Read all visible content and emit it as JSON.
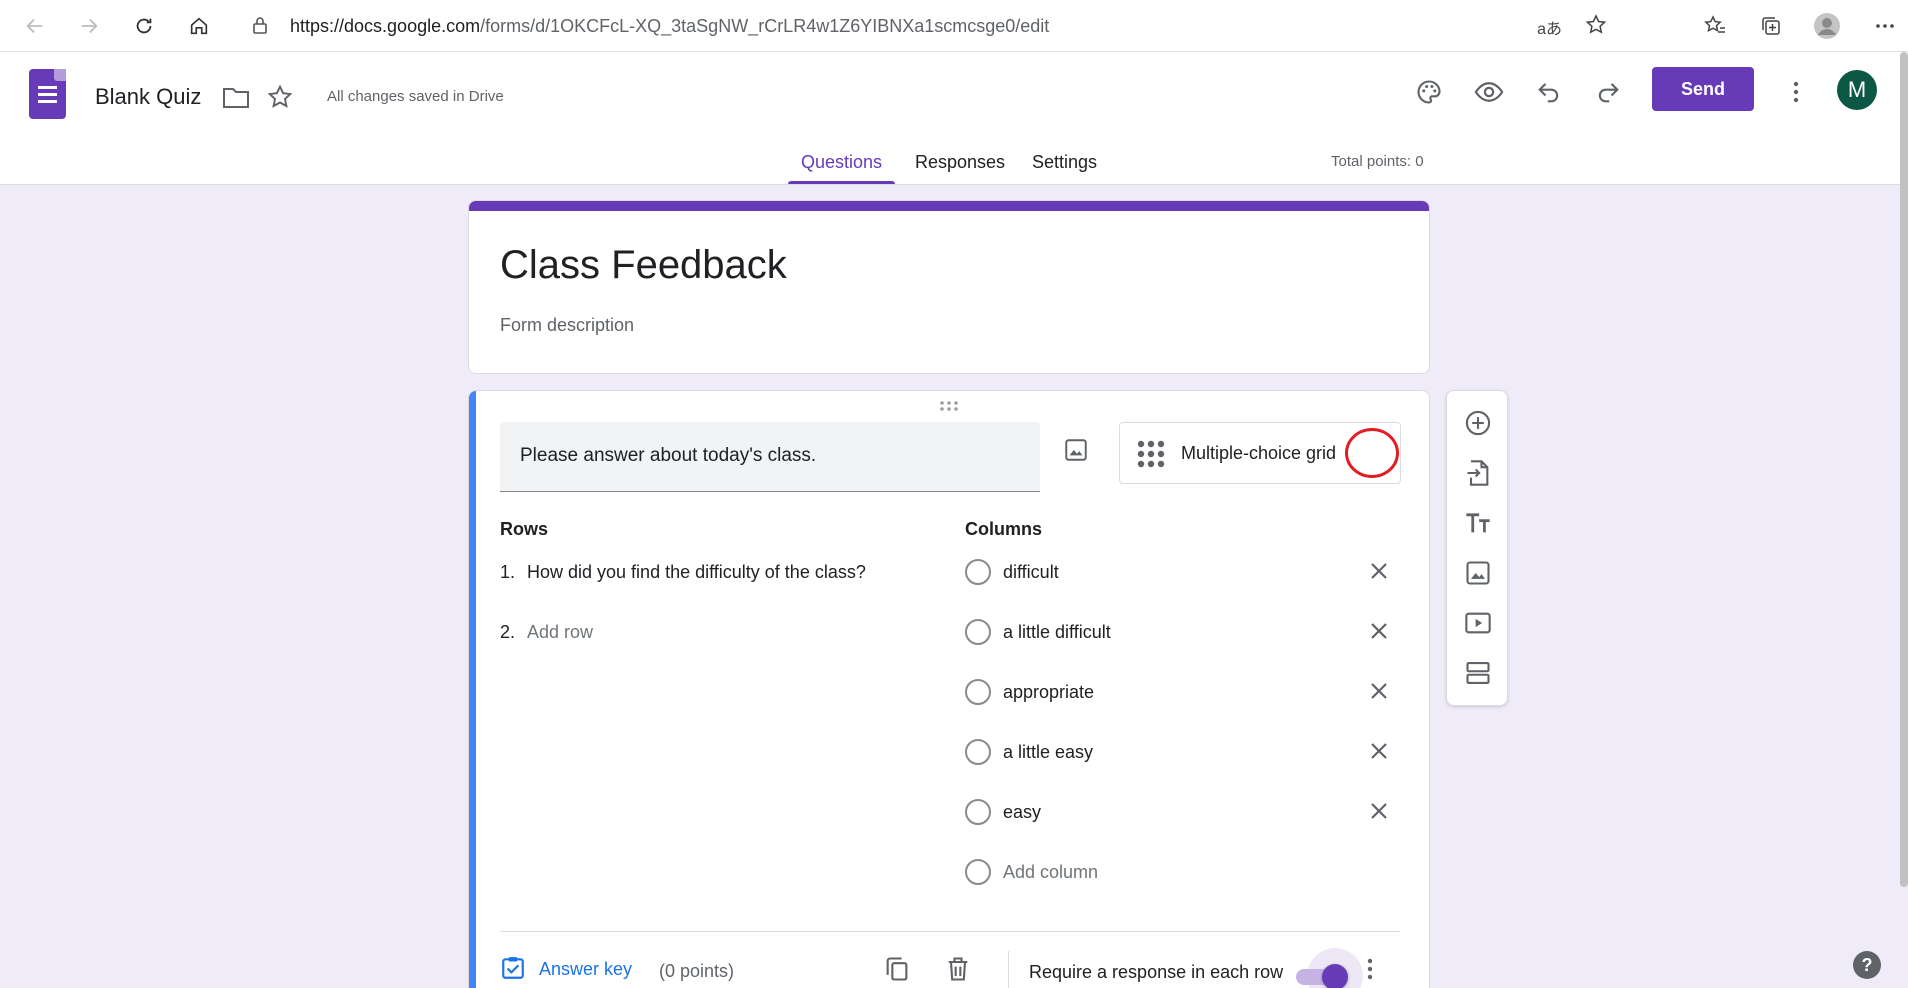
{
  "browser": {
    "url_host": "https://docs.google.com",
    "url_path": "/forms/d/1OKCFcL-XQ_3taSgNW_rCrLR4w1Z6YIBNXa1scmcsge0/edit"
  },
  "header": {
    "doc_title": "Blank Quiz",
    "saved_status": "All changes saved in Drive",
    "send_label": "Send",
    "avatar_initial": "M",
    "tabs": [
      {
        "label": "Questions"
      },
      {
        "label": "Responses"
      },
      {
        "label": "Settings"
      }
    ],
    "total_points": "Total points: 0"
  },
  "form": {
    "title": "Class Feedback",
    "description_placeholder": "Form description"
  },
  "question": {
    "title": "Please answer about today's class.",
    "type": "Multiple-choice grid",
    "rows_label": "Rows",
    "columns_label": "Columns",
    "rows": [
      {
        "num": "1.",
        "text": "How did you find the difficulty of the class?"
      },
      {
        "num": "2.",
        "text": "Add row"
      }
    ],
    "columns": [
      {
        "text": "difficult"
      },
      {
        "text": "a little difficult"
      },
      {
        "text": "appropriate"
      },
      {
        "text": "a little easy"
      },
      {
        "text": "easy"
      },
      {
        "text": "Add column"
      }
    ],
    "answer_key": "Answer key",
    "points": "(0 points)",
    "require_label": "Require a response in each row",
    "require_enabled": true
  },
  "colors": {
    "accent": "#673ab7",
    "active_card": "#4285f4",
    "background": "#f0ebf8",
    "highlight_circle": "#e31c23"
  }
}
